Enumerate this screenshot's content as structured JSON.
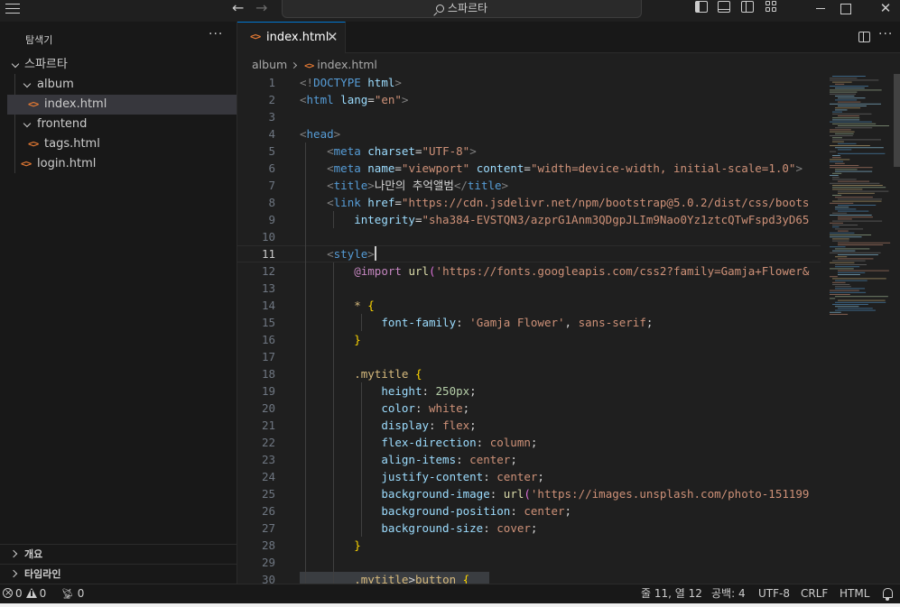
{
  "titlebar": {
    "search_text": "스파르타"
  },
  "sidebar": {
    "header": "탐색기",
    "more": "···",
    "tree": [
      {
        "label": "스파르타",
        "type": "folder",
        "expanded": true,
        "depth": 0
      },
      {
        "label": "album",
        "type": "folder",
        "expanded": true,
        "depth": 1
      },
      {
        "label": "index.html",
        "type": "file",
        "depth": 2,
        "selected": true
      },
      {
        "label": "frontend",
        "type": "folder",
        "expanded": true,
        "depth": 1
      },
      {
        "label": "tags.html",
        "type": "file",
        "depth": 2
      },
      {
        "label": "login.html",
        "type": "file",
        "depth": 1
      }
    ],
    "sections": {
      "outline": "개요",
      "timeline": "타임라인"
    }
  },
  "tabs": {
    "active": "index.html",
    "more": "···"
  },
  "breadcrumb": {
    "folder": "album",
    "file": "index.html"
  },
  "editor": {
    "active_line": 11,
    "line_numbers": [
      "1",
      "2",
      "3",
      "4",
      "5",
      "6",
      "7",
      "8",
      "9",
      "10",
      "11",
      "12",
      "13",
      "14",
      "15",
      "16",
      "17",
      "18",
      "19",
      "20",
      "21",
      "22",
      "23",
      "24",
      "25",
      "26",
      "27",
      "28",
      "29",
      "30"
    ]
  },
  "statusbar": {
    "errors": "0",
    "warnings": "0",
    "ports": "0",
    "position": "줄 11, 열 12",
    "spaces": "공백: 4",
    "encoding": "UTF-8",
    "eol": "CRLF",
    "language": "HTML"
  },
  "colors": {
    "accent": "#0078d4",
    "html_icon": "#e37933",
    "background": "#1f1f1f"
  }
}
